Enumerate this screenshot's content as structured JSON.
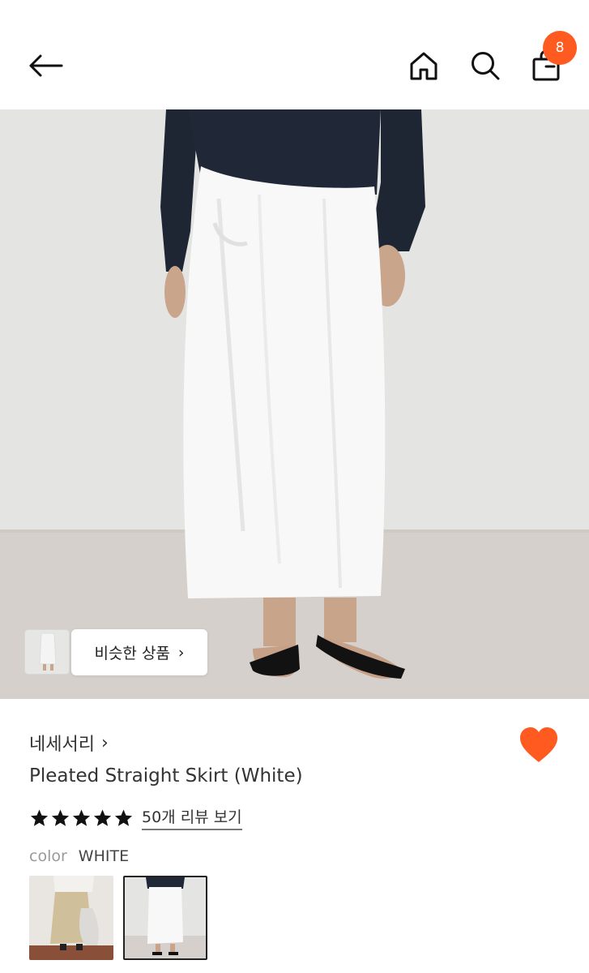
{
  "header": {
    "icons": {
      "back": "arrow-left-icon",
      "home": "home-icon",
      "search": "search-icon",
      "cart": "shopping-bag-icon"
    },
    "cart_badge": "8"
  },
  "hero": {
    "image": "product-photo-white-skirt"
  },
  "similar": {
    "label": "비슷한 상품",
    "chevron": "›"
  },
  "product": {
    "brand": "네세서리",
    "brand_chevron": "›",
    "title": "Pleated Straight Skirt (White)",
    "rating": 5,
    "review_link": "50개 리뷰 보기",
    "liked": true,
    "color_label": "color",
    "color_value": "WHITE",
    "swatches": [
      "beige-variant",
      "white-variant"
    ],
    "selected_swatch": 1
  },
  "colors": {
    "accent": "#ff5a1f",
    "text": "#333333",
    "muted": "#999999"
  }
}
